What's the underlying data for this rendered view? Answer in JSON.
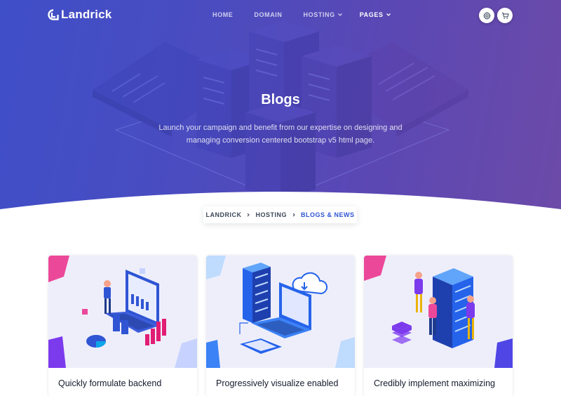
{
  "brand": {
    "name": "Landrick",
    "logo_icon": "landrick-logo-icon"
  },
  "nav": {
    "items": [
      {
        "label": "HOME",
        "dropdown": false
      },
      {
        "label": "DOMAIN",
        "dropdown": false
      },
      {
        "label": "HOSTING",
        "dropdown": true
      },
      {
        "label": "PAGES",
        "dropdown": true,
        "active": true
      }
    ],
    "buttons": [
      {
        "icon": "gear-icon"
      },
      {
        "icon": "shopping-cart-icon"
      }
    ]
  },
  "hero": {
    "title": "Blogs",
    "subtitle": "Launch your campaign and benefit from our expertise on designing and managing conversion centered bootstrap v5 html page."
  },
  "breadcrumb": {
    "items": [
      "LANDRICK",
      "HOSTING"
    ],
    "current": "BLOGS & NEWS"
  },
  "blogs": [
    {
      "title": "Quickly formulate backend",
      "illustration": "data-analytics-illustration"
    },
    {
      "title": "Progressively visualize enabled",
      "illustration": "cloud-server-illustration"
    },
    {
      "title": "Credibly implement maximizing",
      "illustration": "server-team-illustration"
    }
  ],
  "colors": {
    "hero_gradient_start": "#3f4fc8",
    "hero_gradient_end": "#6c4aa8",
    "primary": "#2f55d4",
    "text_dark": "#161c2d",
    "card_image_bg": "#eeeefb"
  }
}
